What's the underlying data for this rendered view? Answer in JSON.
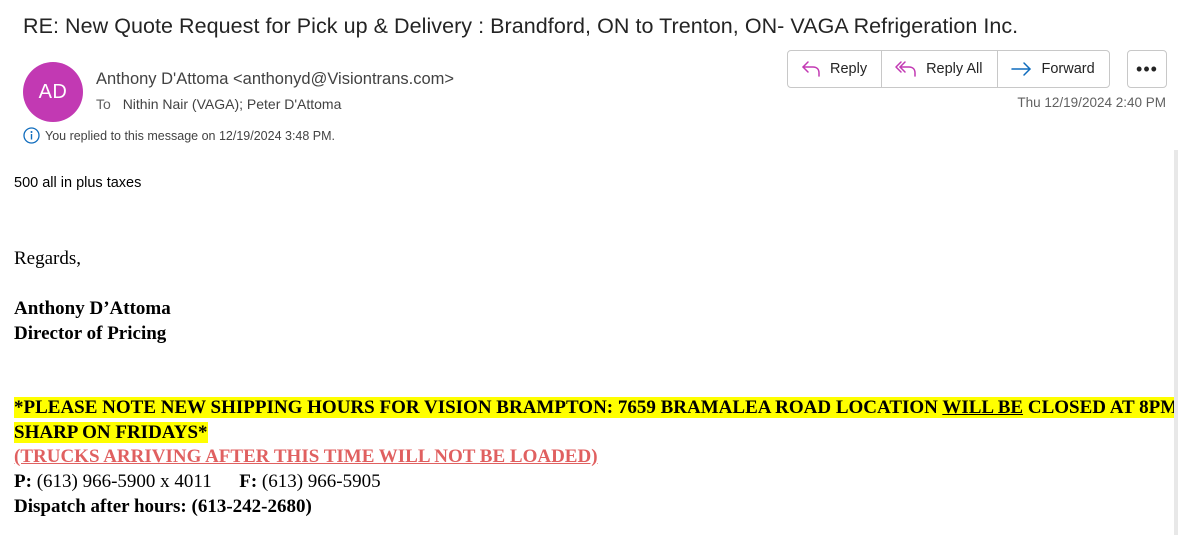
{
  "subject": "RE: New Quote Request for Pick up & Delivery :  Brandford, ON to Trenton, ON- VAGA Refrigeration Inc.",
  "avatar": {
    "initials": "AD",
    "color": "#c239b3"
  },
  "sender": "Anthony D'Attoma <anthonyd@Visiontrans.com>",
  "recipients": {
    "label": "To",
    "names": "Nithin Nair (VAGA); Peter D'Attoma"
  },
  "replied_notice": "You replied to this message on 12/19/2024 3:48 PM.",
  "actions": {
    "reply": "Reply",
    "reply_all": "Reply All",
    "forward": "Forward",
    "more": "•••"
  },
  "date": "Thu 12/19/2024 2:40 PM",
  "body": {
    "line1": "500 all in plus taxes",
    "regards": "Regards,",
    "name": "Anthony D’Attoma",
    "title": "Director of Pricing",
    "notice_part1": "*PLEASE NOTE NEW SHIPPING HOURS FOR VISION BRAMPTON: 7659 BRAMALEA ROAD LOCATION ",
    "notice_underlined": "WILL BE",
    "notice_part2": " CLOSED AT 8PM",
    "notice_line2": "SHARP ON FRIDAYS*",
    "trucks_notice": "(TRUCKS ARRIVING AFTER THIS TIME WILL NOT BE LOADED)",
    "phone_label": "P:",
    "phone": "(613) 966-5900 x 4011",
    "fax_label": "F:",
    "fax": "(613) 966-5905",
    "dispatch": "Dispatch after hours:  (613-242-2680)"
  },
  "colors": {
    "accent": "#0f6cbd",
    "reply_icon": "#c239b3",
    "highlight": "#ffff00",
    "warning_red": "#e06060"
  }
}
